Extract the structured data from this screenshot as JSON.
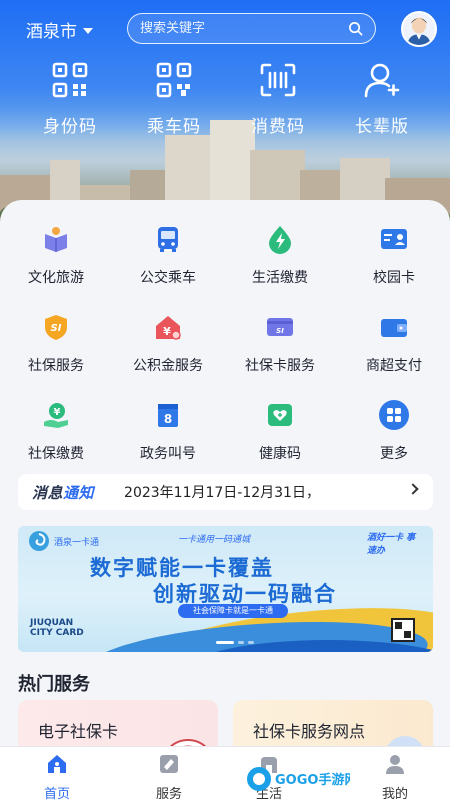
{
  "header": {
    "city": "酒泉市",
    "search_placeholder": "搜索关键字"
  },
  "quick_codes": [
    {
      "label": "身份码",
      "icon": "qr-code-icon"
    },
    {
      "label": "乘车码",
      "icon": "bus-qr-icon"
    },
    {
      "label": "消费码",
      "icon": "scan-icon"
    },
    {
      "label": "长辈版",
      "icon": "elder-icon"
    }
  ],
  "services": [
    {
      "label": "文化旅游",
      "icon": "culture-tourism-icon"
    },
    {
      "label": "公交乘车",
      "icon": "bus-icon"
    },
    {
      "label": "生活缴费",
      "icon": "utility-payment-icon"
    },
    {
      "label": "校园卡",
      "icon": "campus-card-icon"
    },
    {
      "label": "社保服务",
      "icon": "social-security-icon"
    },
    {
      "label": "公积金服务",
      "icon": "housing-fund-icon"
    },
    {
      "label": "社保卡服务",
      "icon": "social-card-icon"
    },
    {
      "label": "商超支付",
      "icon": "wallet-icon"
    },
    {
      "label": "社保缴费",
      "icon": "social-payment-icon"
    },
    {
      "label": "政务叫号",
      "icon": "queue-number-icon"
    },
    {
      "label": "健康码",
      "icon": "health-code-icon"
    },
    {
      "label": "更多",
      "icon": "more-grid-icon"
    }
  ],
  "notice": {
    "tag_part1": "消息",
    "tag_part2": "通知",
    "text": "2023年11月17日-12月31日，"
  },
  "banner": {
    "logo_text": "酒泉一卡通",
    "tagline": "一卡通用一码通城",
    "title_line1": "数字赋能一卡覆盖",
    "title_line2": "创新驱动一码融合",
    "pill": "社会保障卡就是一卡通",
    "en_line1": "JIUQUAN",
    "en_line2": "CITY CARD",
    "stamp": "酒好一卡 事速办"
  },
  "hot_services": {
    "title": "热门服务",
    "items": [
      {
        "label": "电子社保卡"
      },
      {
        "label": "社保卡服务网点"
      }
    ]
  },
  "tabs": [
    {
      "label": "首页",
      "icon": "home-icon",
      "active": true
    },
    {
      "label": "服务",
      "icon": "service-icon",
      "active": false
    },
    {
      "label": "生活",
      "icon": "life-icon",
      "active": false
    },
    {
      "label": "我的",
      "icon": "profile-icon",
      "active": false
    }
  ],
  "watermark": "GOGO手游网",
  "colors": {
    "primary": "#2d6cf0",
    "header_blue": "#1f6ef5",
    "background": "#f3f5f9"
  }
}
